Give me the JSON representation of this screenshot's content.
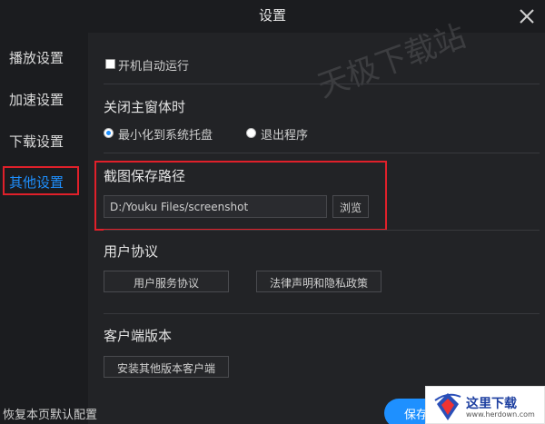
{
  "window": {
    "title": "设置",
    "watermark": "天极下载站"
  },
  "sidebar": {
    "items": [
      {
        "label": "播放设置"
      },
      {
        "label": "加速设置"
      },
      {
        "label": "下载设置"
      },
      {
        "label": "其他设置",
        "active": true
      }
    ]
  },
  "general": {
    "autostart_label": "开机自动运行",
    "autostart_checked": false
  },
  "close_window": {
    "title": "关闭主窗体时",
    "options": [
      {
        "label": "最小化到系统托盘",
        "selected": true
      },
      {
        "label": "退出程序",
        "selected": false
      }
    ]
  },
  "screenshot": {
    "title": "截图保存路径",
    "path": "D:/Youku Files/screenshot",
    "browse_label": "浏览"
  },
  "agreement": {
    "title": "用户协议",
    "user_service": "用户服务协议",
    "legal_privacy": "法律声明和隐私政策"
  },
  "client_version": {
    "title": "客户端版本",
    "install_other": "安装其他版本客户端"
  },
  "footer": {
    "restore_default": "恢复本页默认配置",
    "save_label": "保存"
  },
  "site_logo": {
    "text": "这里下载",
    "url": "www.herdown.com"
  },
  "colors": {
    "accent": "#1e90ff",
    "highlight_red": "#e0202a",
    "background": "#222326",
    "sidebar": "#1b1c1f"
  }
}
